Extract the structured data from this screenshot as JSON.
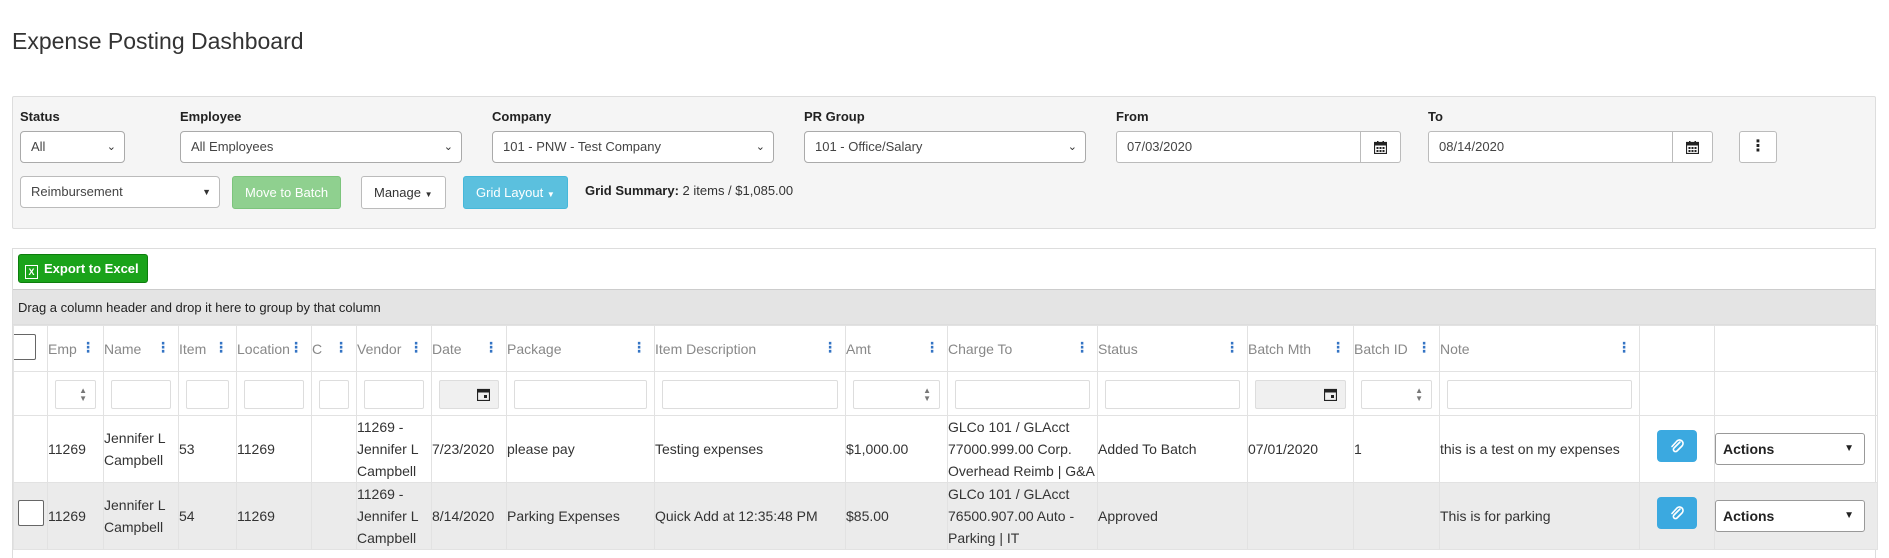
{
  "page_title": "Expense Posting Dashboard",
  "filters": {
    "status": {
      "label": "Status",
      "value": "All"
    },
    "employee": {
      "label": "Employee",
      "value": "All Employees"
    },
    "company": {
      "label": "Company",
      "value": "101 - PNW - Test Company"
    },
    "pr_group": {
      "label": "PR Group",
      "value": "101 - Office/Salary"
    },
    "from": {
      "label": "From",
      "value": "07/03/2020"
    },
    "to": {
      "label": "To",
      "value": "08/14/2020"
    }
  },
  "toolbar": {
    "type_value": "Reimbursement",
    "move_to_batch": "Move to Batch",
    "manage": "Manage",
    "grid_layout": "Grid Layout",
    "summary_label": "Grid Summary:",
    "summary_value": "2 items / $1,085.00"
  },
  "grid": {
    "export_label": "Export to Excel",
    "group_hint": "Drag a column header and drop it here to group by that column",
    "columns": [
      "Emp",
      "Name",
      "Item",
      "Location",
      "C",
      "Vendor",
      "Date",
      "Package",
      "Item Description",
      "Amt",
      "Charge To",
      "Status",
      "Batch Mth",
      "Batch ID",
      "Note"
    ],
    "rows": [
      {
        "emp": "11269",
        "name": "Jennifer L Campbell",
        "item": "53",
        "location": "11269",
        "c": "",
        "vendor": "11269 - Jennifer L Campbell",
        "date": "7/23/2020",
        "package": "please pay",
        "description": "Testing expenses",
        "amt": "$1,000.00",
        "charge_to": "GLCo 101 / GLAcct 77000.999.00 Corp. Overhead Reimb | G&A",
        "status": "Added To Batch",
        "batch_mth": "07/01/2020",
        "batch_id": "1",
        "note": "this is a test on my expenses",
        "actions": "Actions"
      },
      {
        "emp": "11269",
        "name": "Jennifer L Campbell",
        "item": "54",
        "location": "11269",
        "c": "",
        "vendor": "11269 - Jennifer L Campbell",
        "date": "8/14/2020",
        "package": "Parking Expenses",
        "description": "Quick Add at 12:35:48 PM",
        "amt": "$85.00",
        "charge_to": "GLCo 101 / GLAcct 76500.907.00 Auto - Parking | IT",
        "status": "Approved",
        "batch_mth": "",
        "batch_id": "",
        "note": "This is for parking",
        "actions": "Actions"
      }
    ]
  },
  "icons": {
    "calendar": "calendar-icon",
    "kebab": "vertical-ellipsis-icon",
    "paperclip": "paperclip-icon",
    "excel": "excel-icon"
  },
  "colors": {
    "accent_blue": "#3ba9e0",
    "export_green": "#1aa31a",
    "move_to_batch_green": "#8fd08f",
    "header_dots": "#3474c4"
  }
}
